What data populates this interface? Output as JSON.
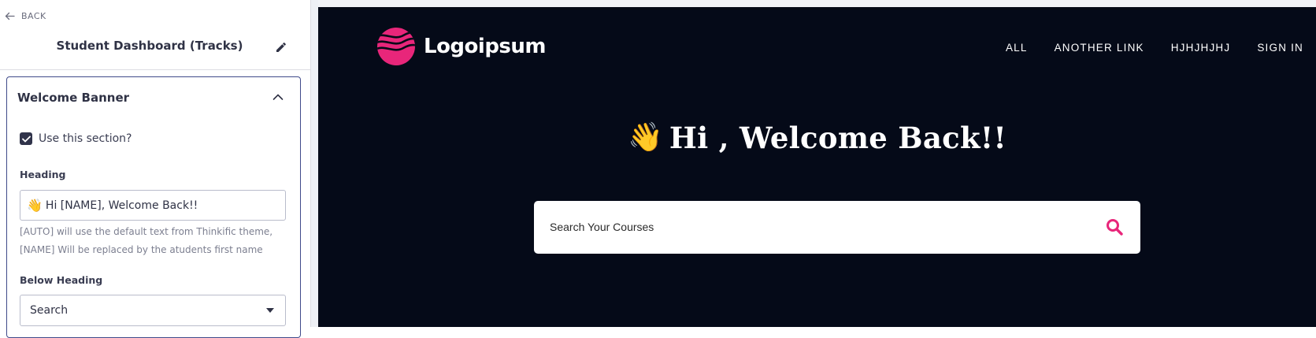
{
  "editor": {
    "back_label": "BACK",
    "page_title": "Student Dashboard (Tracks)",
    "section": {
      "title": "Welcome Banner",
      "use_section_label": "Use this section?",
      "use_section_checked": true,
      "heading_label": "Heading",
      "heading_emoji": "👋",
      "heading_value": "Hi [NAME], Welcome Back!!",
      "help_line1": "[AUTO] will use the default text from Thinkific theme,",
      "help_line2": "[NAME] Will be replaced by the atudents first name",
      "below_heading_label": "Below Heading",
      "below_heading_value": "Search"
    }
  },
  "preview": {
    "logo_text": "Logoipsum",
    "nav": [
      "ALL",
      "ANOTHER LINK",
      "HJHJHJHJ",
      "SIGN IN"
    ],
    "hero_emoji": "👋",
    "hero_title": "Hi , Welcome Back!!",
    "search_placeholder": "Search Your Courses"
  },
  "colors": {
    "preview_bg": "#050a18",
    "accent_pink": "#e8267a",
    "checkbox": "#30334a",
    "card_border": "#3f4a8a"
  },
  "icons": [
    "arrow-left-icon",
    "pencil-icon",
    "chevron-up-icon",
    "check-icon",
    "caret-down-icon",
    "search-icon"
  ]
}
